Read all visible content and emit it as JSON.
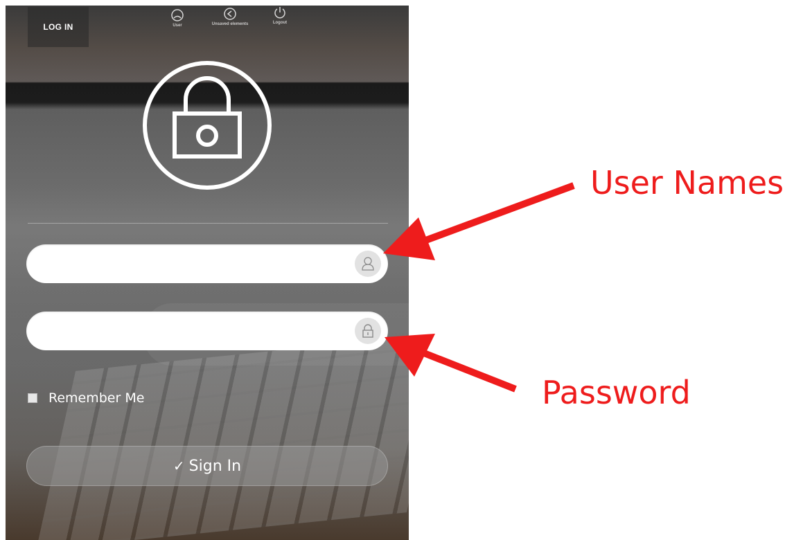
{
  "header": {
    "login_tab": "LOG IN",
    "icons": [
      {
        "name": "user-icon",
        "label": "User"
      },
      {
        "name": "back-icon",
        "label": "Unsaved elements"
      },
      {
        "name": "power-icon",
        "label": "Logout"
      }
    ]
  },
  "form": {
    "username": {
      "value": "",
      "placeholder": "",
      "icon": "user-icon"
    },
    "password": {
      "value": "",
      "placeholder": "",
      "icon": "padlock-icon"
    },
    "remember_label": "Remember Me",
    "signin_check": "✓",
    "signin_label": "Sign In"
  },
  "annotations": {
    "username_label": "User Names",
    "password_label": "Password"
  },
  "colors": {
    "annotation": "#ee1c1c",
    "field_bg": "#ffffff",
    "icon_circle": "#e2e2e2"
  }
}
